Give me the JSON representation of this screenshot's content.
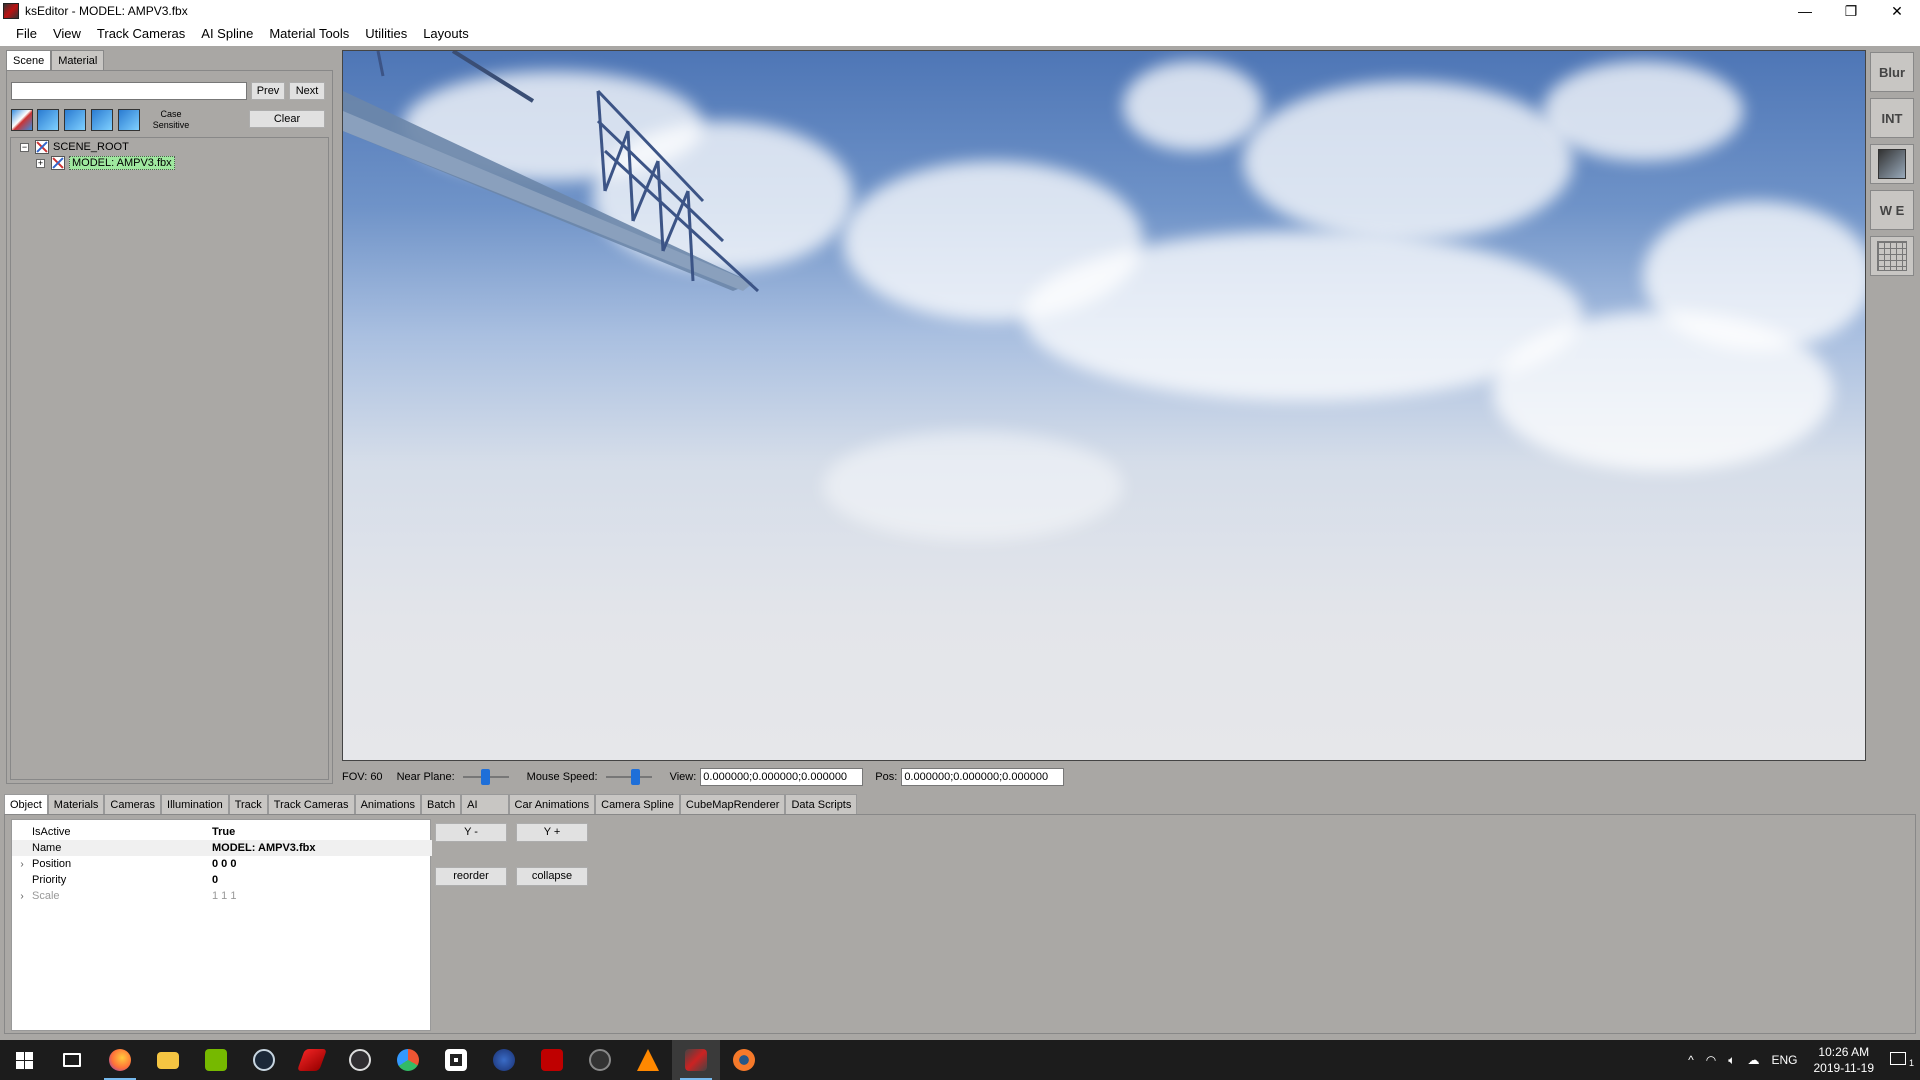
{
  "window": {
    "title": "ksEditor - MODEL: AMPV3.fbx",
    "minimize": "—",
    "restore": "❐",
    "close": "✕"
  },
  "menu": [
    "File",
    "View",
    "Track Cameras",
    "AI Spline",
    "Material Tools",
    "Utilities",
    "Layouts"
  ],
  "left_panel": {
    "tabs": [
      "Scene",
      "Material"
    ],
    "search_value": "",
    "prev_label": "Prev",
    "next_label": "Next",
    "case_sensitive_label": "Case Sensitive",
    "clear_label": "Clear",
    "tree": [
      {
        "label": "SCENE_ROOT",
        "toggle": "−"
      },
      {
        "label": "MODEL: AMPV3.fbx",
        "toggle": "+"
      }
    ]
  },
  "right_tools": {
    "blur_label": "Blur",
    "int_label": "INT",
    "we_label": "W E"
  },
  "viewport_status": {
    "fov_label": "FOV: 60",
    "near_plane_label": "Near Plane:",
    "near_plane_level": 0.5,
    "mouse_speed_label": "Mouse Speed:",
    "mouse_speed_level": 0.7,
    "view_label": "View:",
    "view_value": "0.000000;0.000000;0.000000",
    "pos_label": "Pos:",
    "pos_value": "0.000000;0.000000;0.000000"
  },
  "bottom_tabs": [
    "Object",
    "Materials",
    "Cameras",
    "Illumination",
    "Track",
    "Track Cameras",
    "Animations",
    "Batch",
    "AI",
    "Car Animations",
    "Camera Spline",
    "CubeMapRenderer",
    "Data Scripts"
  ],
  "properties": [
    {
      "name": "IsActive",
      "value": "True",
      "expand": ""
    },
    {
      "name": "Name",
      "value": "MODEL: AMPV3.fbx",
      "expand": ""
    },
    {
      "name": "Position",
      "value": "0 0 0",
      "expand": "›"
    },
    {
      "name": "Priority",
      "value": "0",
      "expand": ""
    },
    {
      "name": "Scale",
      "value": "1 1 1",
      "expand": "›"
    }
  ],
  "actions": {
    "y_minus": "Y -",
    "y_plus": "Y +",
    "reorder": "reorder",
    "collapse": "collapse"
  },
  "taskbar": {
    "apps": [
      "start",
      "task-view",
      "firefox",
      "file-explorer",
      "nvidia",
      "steam",
      "app-red",
      "obs",
      "davinci",
      "roblox",
      "app-globe",
      "filezilla",
      "app-circle",
      "vlc",
      "kseditor",
      "blender"
    ],
    "lang": "ENG",
    "time": "10:26 AM",
    "date": "2019-11-19",
    "notification_count": "1"
  }
}
